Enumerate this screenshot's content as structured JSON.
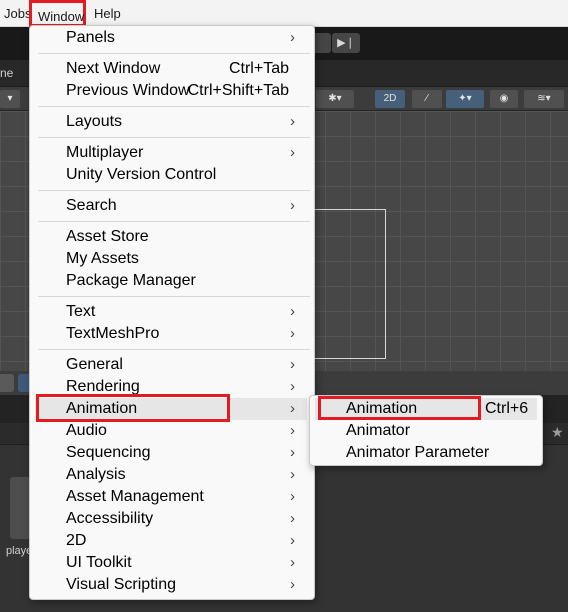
{
  "menubar": {
    "jobs": "Jobs",
    "window": "Window",
    "help": "Help"
  },
  "editor": {
    "scene_tab": "ne",
    "tool_2d": "2D",
    "asset_label": "playe"
  },
  "window_menu": {
    "items": [
      {
        "label": "Panels",
        "shortcut": "",
        "submenu": true
      },
      {
        "label": "Next Window",
        "shortcut": "Ctrl+Tab",
        "submenu": false
      },
      {
        "label": "Previous Window",
        "shortcut": "Ctrl+Shift+Tab",
        "submenu": false
      },
      {
        "label": "Layouts",
        "shortcut": "",
        "submenu": true
      },
      {
        "label": "Multiplayer",
        "shortcut": "",
        "submenu": true
      },
      {
        "label": "Unity Version Control",
        "shortcut": "",
        "submenu": false
      },
      {
        "label": "Search",
        "shortcut": "",
        "submenu": true
      },
      {
        "label": "Asset Store",
        "shortcut": "",
        "submenu": false
      },
      {
        "label": "My Assets",
        "shortcut": "",
        "submenu": false
      },
      {
        "label": "Package Manager",
        "shortcut": "",
        "submenu": false
      },
      {
        "label": "Text",
        "shortcut": "",
        "submenu": true
      },
      {
        "label": "TextMeshPro",
        "shortcut": "",
        "submenu": true
      },
      {
        "label": "General",
        "shortcut": "",
        "submenu": true
      },
      {
        "label": "Rendering",
        "shortcut": "",
        "submenu": true
      },
      {
        "label": "Animation",
        "shortcut": "",
        "submenu": true
      },
      {
        "label": "Audio",
        "shortcut": "",
        "submenu": true
      },
      {
        "label": "Sequencing",
        "shortcut": "",
        "submenu": true
      },
      {
        "label": "Analysis",
        "shortcut": "",
        "submenu": true
      },
      {
        "label": "Asset Management",
        "shortcut": "",
        "submenu": true
      },
      {
        "label": "Accessibility",
        "shortcut": "",
        "submenu": true
      },
      {
        "label": "2D",
        "shortcut": "",
        "submenu": true
      },
      {
        "label": "UI Toolkit",
        "shortcut": "",
        "submenu": true
      },
      {
        "label": "Visual Scripting",
        "shortcut": "",
        "submenu": true
      }
    ]
  },
  "animation_submenu": {
    "items": [
      {
        "label": "Animation",
        "shortcut": "Ctrl+6"
      },
      {
        "label": "Animator",
        "shortcut": ""
      },
      {
        "label": "Animator Parameter",
        "shortcut": ""
      }
    ]
  }
}
